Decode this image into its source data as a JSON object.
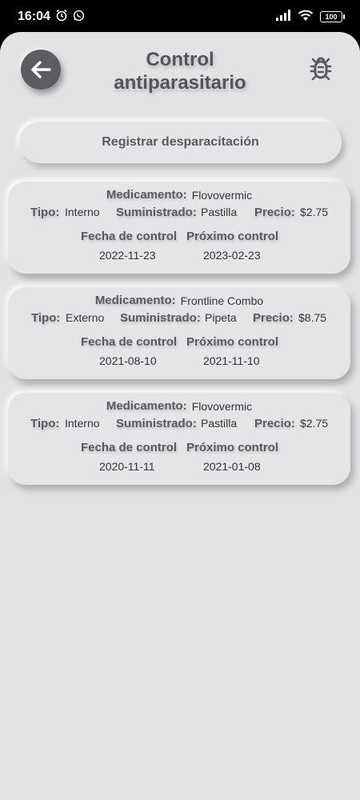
{
  "status": {
    "time": "16:04",
    "battery": "100"
  },
  "header": {
    "title_line1": "Control",
    "title_line2": "antiparasitario"
  },
  "register_button": "Registrar desparacitación",
  "labels": {
    "medicamento": "Medicamento:",
    "tipo": "Tipo:",
    "suministrado": "Suministrado:",
    "precio": "Precio:",
    "fecha_control": "Fecha de control",
    "proximo_control": "Próximo control"
  },
  "records": [
    {
      "medicamento": "Flovovermic",
      "tipo": "Interno",
      "suministrado": "Pastilla",
      "precio": "$2.75",
      "fecha": "2022-11-23",
      "proximo": "2023-02-23"
    },
    {
      "medicamento": "Frontline Combo",
      "tipo": "Externo",
      "suministrado": "Pipeta",
      "precio": "$8.75",
      "fecha": "2021-08-10",
      "proximo": "2021-11-10"
    },
    {
      "medicamento": "Flovovermic",
      "tipo": "Interno",
      "suministrado": "Pastilla",
      "precio": "$2.75",
      "fecha": "2020-11-11",
      "proximo": "2021-01-08"
    }
  ],
  "colors": {
    "background": "#e3e2e5",
    "accent_dark": "#5d5c60",
    "label_text": "#5a595d"
  },
  "icons": {
    "back": "arrow-left-icon",
    "settings": "bug-icon",
    "status": [
      "alarm-icon",
      "whatsapp-icon",
      "signal-icon",
      "wifi-icon",
      "battery-icon"
    ]
  }
}
